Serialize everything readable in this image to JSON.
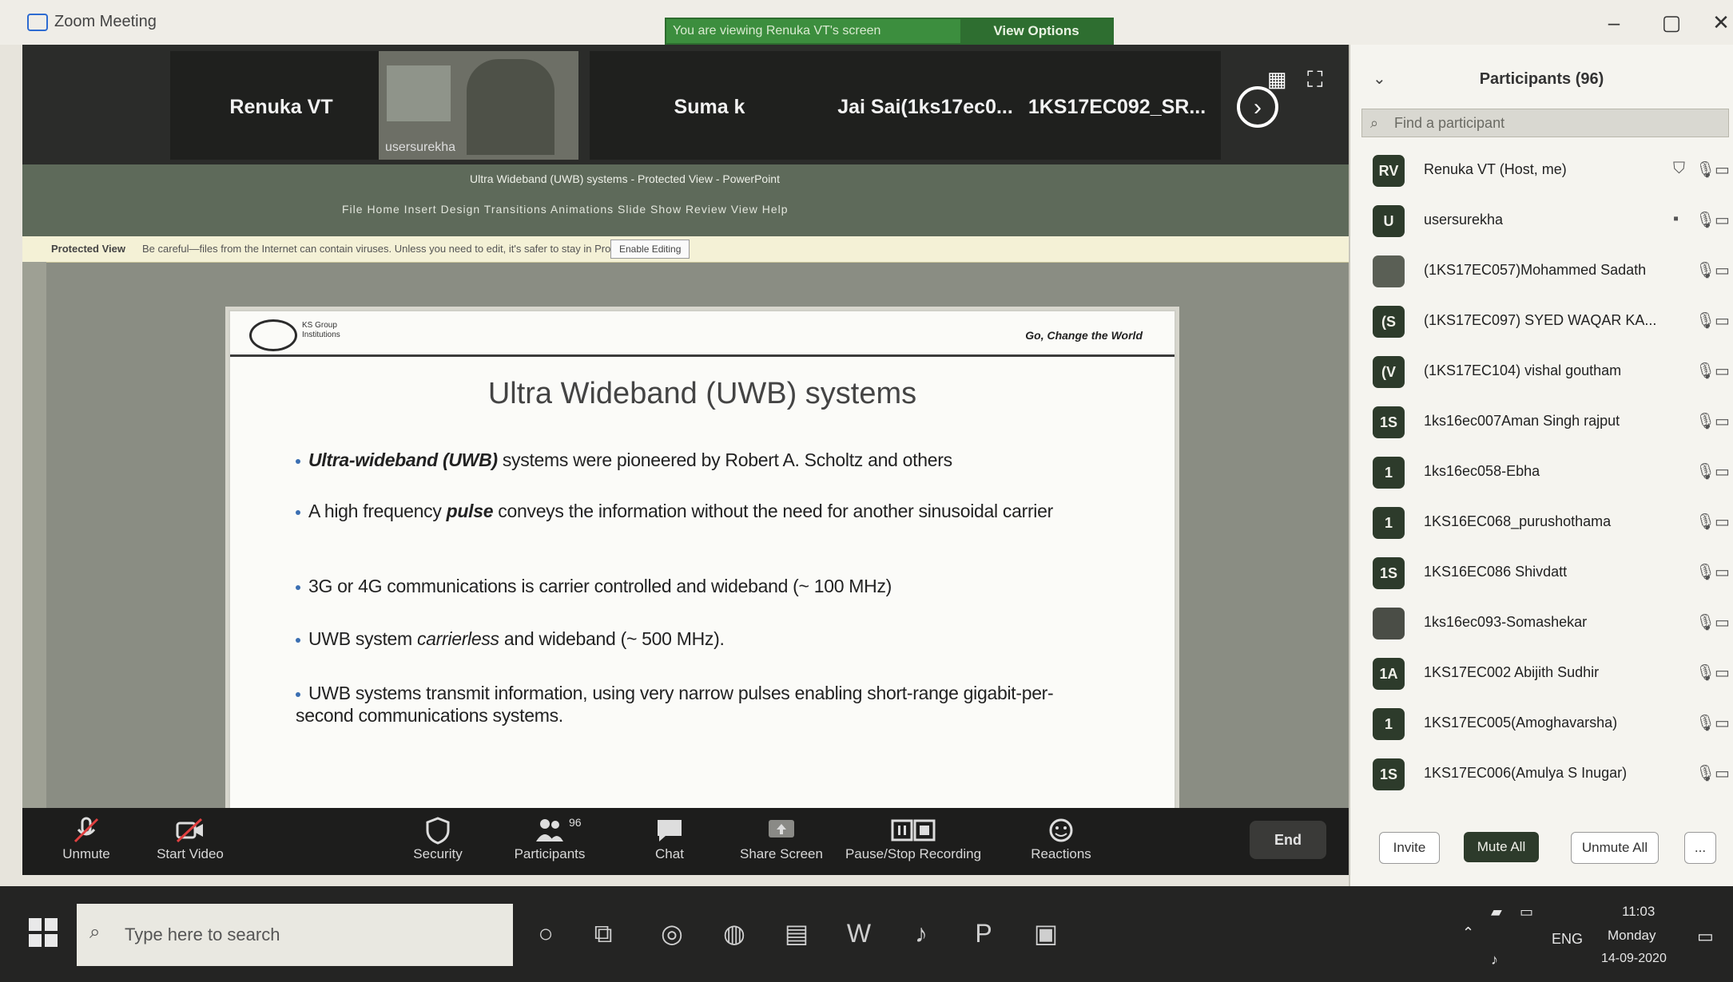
{
  "window": {
    "title": "Zoom Meeting"
  },
  "share_banner": {
    "text": "You are viewing Renuka VT's screen",
    "view_options": "View Options"
  },
  "video_strip": {
    "tiles": [
      {
        "name": "Renuka VT"
      },
      {
        "name": "usersurekha"
      },
      {
        "name": "Suma k"
      },
      {
        "name": "Jai Sai(1ks17ec0..."
      },
      {
        "name": "1KS17EC092_SR..."
      }
    ]
  },
  "powerpoint": {
    "doc_title": "Ultra Wideband (UWB) systems - Protected View - PowerPoint",
    "ribbon_tabs": "File   Home   Insert   Design   Transitions   Animations   Slide Show   Review   View   Help",
    "protected_label": "Protected View",
    "protected_msg": "Be careful—files from the Internet can contain viruses. Unless you need to edit, it's safer to stay in Protected View.",
    "enable_editing": "Enable Editing"
  },
  "slide": {
    "tagline": "Go, Change the World",
    "title": "Ultra Wideband (UWB) systems",
    "bullets": [
      {
        "em": "Ultra-wideband (UWB)",
        "text": " systems were pioneered by Robert A. Scholtz and others"
      },
      {
        "pre": "A high frequency ",
        "em": "pulse",
        "text": " conveys the information without the need for another sinusoidal carrier"
      },
      {
        "text": "3G or 4G communications is carrier controlled and wideband (~ 100 MHz)"
      },
      {
        "pre": "UWB system ",
        "em": "carrierless",
        "text": " and wideband (~ 500 MHz)."
      },
      {
        "text": "UWB  systems transmit information, using very narrow pulses enabling short-range gigabit-per-second communications systems."
      }
    ]
  },
  "toolbar": {
    "unmute": "Unmute",
    "start_video": "Start Video",
    "security": "Security",
    "participants": "Participants",
    "participants_count": "96",
    "chat": "Chat",
    "share_screen": "Share Screen",
    "pause_recording": "Pause/Stop Recording",
    "reactions": "Reactions",
    "end": "End"
  },
  "participants": {
    "title": "Participants (96)",
    "search_placeholder": "Find a participant",
    "list": [
      {
        "initials": "RV",
        "name": "Renuka VT (Host, me)"
      },
      {
        "initials": "U",
        "name": "usersurekha"
      },
      {
        "initials": "",
        "name": "(1KS17EC057)Mohammed Sadath"
      },
      {
        "initials": "(S",
        "name": "(1KS17EC097) SYED WAQAR KA..."
      },
      {
        "initials": "(V",
        "name": "(1KS17EC104) vishal goutham"
      },
      {
        "initials": "1S",
        "name": "1ks16ec007Aman Singh rajput"
      },
      {
        "initials": "1",
        "name": "1ks16ec058-Ebha"
      },
      {
        "initials": "1",
        "name": "1KS16EC068_purushothama"
      },
      {
        "initials": "1S",
        "name": "1KS16EC086 Shivdatt"
      },
      {
        "initials": "",
        "name": "1ks16ec093-Somashekar"
      },
      {
        "initials": "1A",
        "name": "1KS17EC002 Abijith Sudhir"
      },
      {
        "initials": "1",
        "name": "1KS17EC005(Amoghavarsha)"
      },
      {
        "initials": "1S",
        "name": "1KS17EC006(Amulya S Inugar)"
      }
    ],
    "invite": "Invite",
    "mute_all": "Mute All",
    "unmute_all": "Unmute All",
    "more": "..."
  },
  "taskbar": {
    "search_placeholder": "Type here to search",
    "lang": "ENG",
    "time": "11:03",
    "day": "Monday",
    "date": "14-09-2020"
  }
}
